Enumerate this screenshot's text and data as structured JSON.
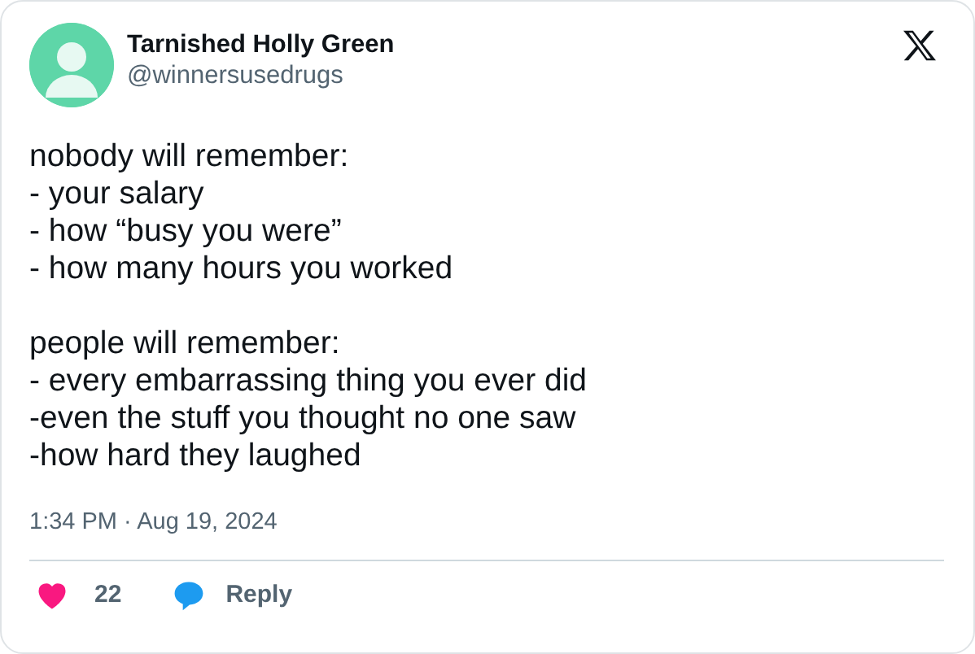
{
  "author": {
    "name": "Tarnished Holly Green",
    "handle": "@winnersusedrugs"
  },
  "paragraphs": [
    {
      "lines": [
        "nobody will remember:",
        "- your salary",
        "- how “busy you were”",
        "- how many hours you worked"
      ]
    },
    {
      "lines": [
        "people will remember:",
        "- every embarrassing thing you ever did",
        "-even the stuff you thought no one saw",
        "-how hard they laughed"
      ]
    }
  ],
  "timestamp": "1:34 PM · Aug 19, 2024",
  "actions": [
    {
      "kind": "like",
      "label": "22"
    },
    {
      "kind": "reply",
      "label": "Reply"
    }
  ]
}
